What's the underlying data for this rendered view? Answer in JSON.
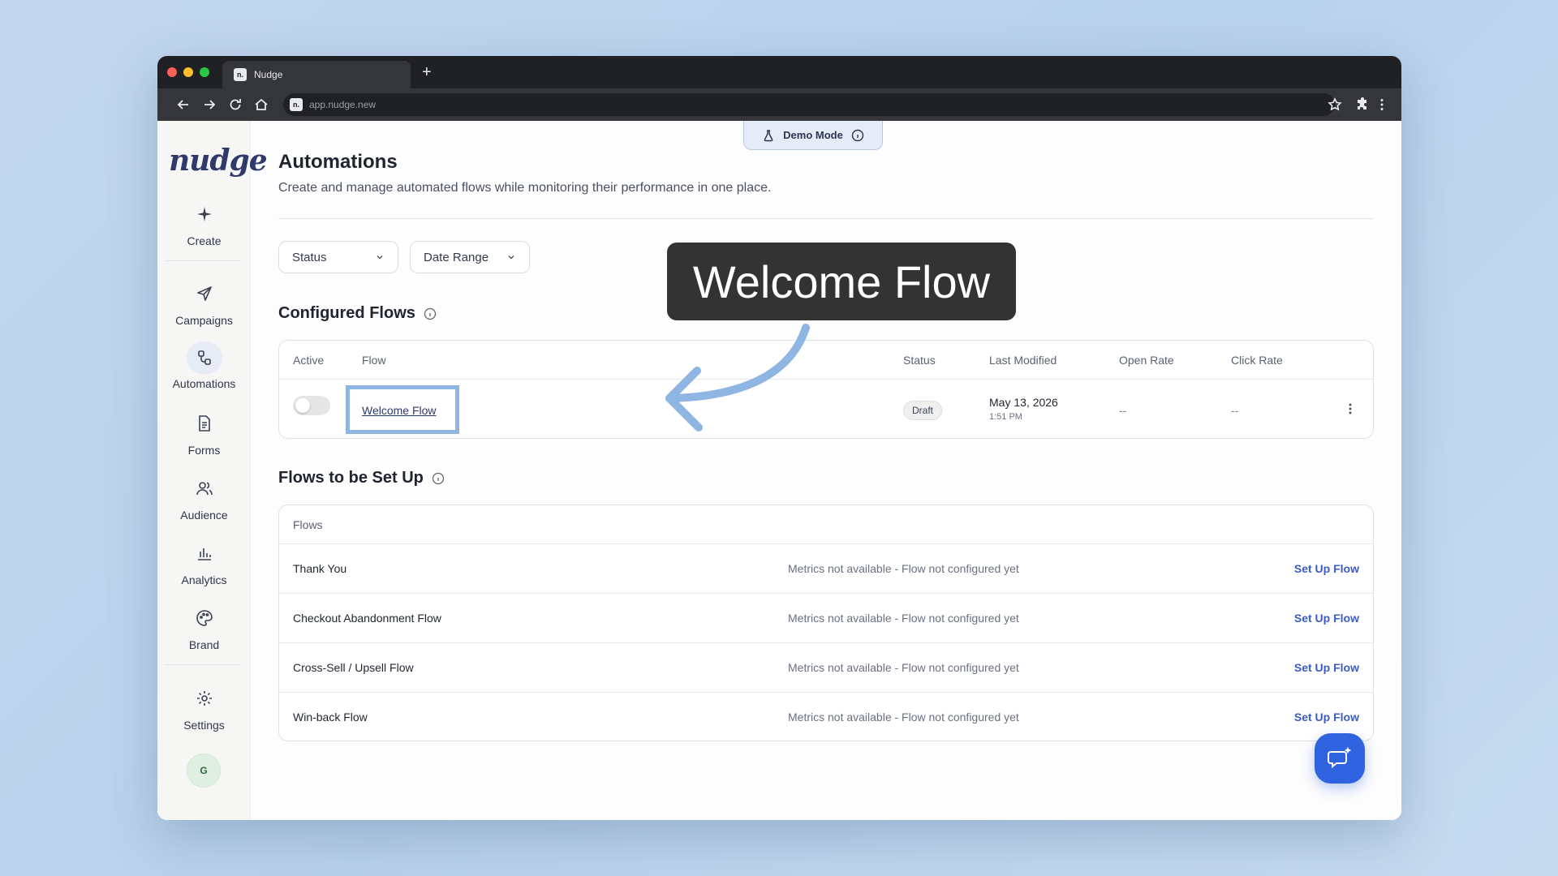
{
  "browser": {
    "tab_title": "Nudge",
    "favicon_text": "n.",
    "new_tab": "+",
    "url": "app.nudge.new"
  },
  "sidebar": {
    "logo": "nudge",
    "items": [
      {
        "label": "Create",
        "icon": "sparkle-icon"
      },
      {
        "label": "Campaigns",
        "icon": "send-icon"
      },
      {
        "label": "Automations",
        "icon": "flow-icon",
        "active": true
      },
      {
        "label": "Forms",
        "icon": "document-icon"
      },
      {
        "label": "Audience",
        "icon": "users-icon"
      },
      {
        "label": "Analytics",
        "icon": "bar-chart-icon"
      },
      {
        "label": "Brand",
        "icon": "palette-icon"
      },
      {
        "label": "Settings",
        "icon": "gear-icon"
      }
    ],
    "avatar_initial": "G"
  },
  "demo_mode": {
    "label": "Demo Mode"
  },
  "page": {
    "title": "Automations",
    "subtitle": "Create and manage automated flows while monitoring their performance in one place."
  },
  "filters": {
    "status_label": "Status",
    "date_range_label": "Date Range"
  },
  "configured": {
    "title": "Configured Flows",
    "columns": [
      "Active",
      "Flow",
      "Status",
      "Last Modified",
      "Open Rate",
      "Click Rate"
    ],
    "rows": [
      {
        "active": false,
        "flow": "Welcome Flow",
        "status": "Draft",
        "modified_date": "May 13, 2026",
        "modified_time": "1:51 PM",
        "open_rate": "--",
        "click_rate": "--"
      }
    ]
  },
  "setup": {
    "title": "Flows to be Set Up",
    "column": "Flows",
    "rows": [
      {
        "name": "Thank You",
        "metric": "Metrics not available - Flow not configured yet",
        "action": "Set Up Flow"
      },
      {
        "name": "Checkout Abandonment Flow",
        "metric": "Metrics not available - Flow not configured yet",
        "action": "Set Up Flow"
      },
      {
        "name": "Cross-Sell / Upsell Flow",
        "metric": "Metrics not available - Flow not configured yet",
        "action": "Set Up Flow"
      },
      {
        "name": "Win-back Flow",
        "metric": "Metrics not available - Flow not configured yet",
        "action": "Set Up Flow"
      }
    ]
  },
  "callout": {
    "text": "Welcome Flow"
  },
  "colors": {
    "accent": "#3b5cc4",
    "chat_button": "#2f63e0",
    "highlight": "#8fb5e3",
    "callout_bg": "#333333"
  }
}
